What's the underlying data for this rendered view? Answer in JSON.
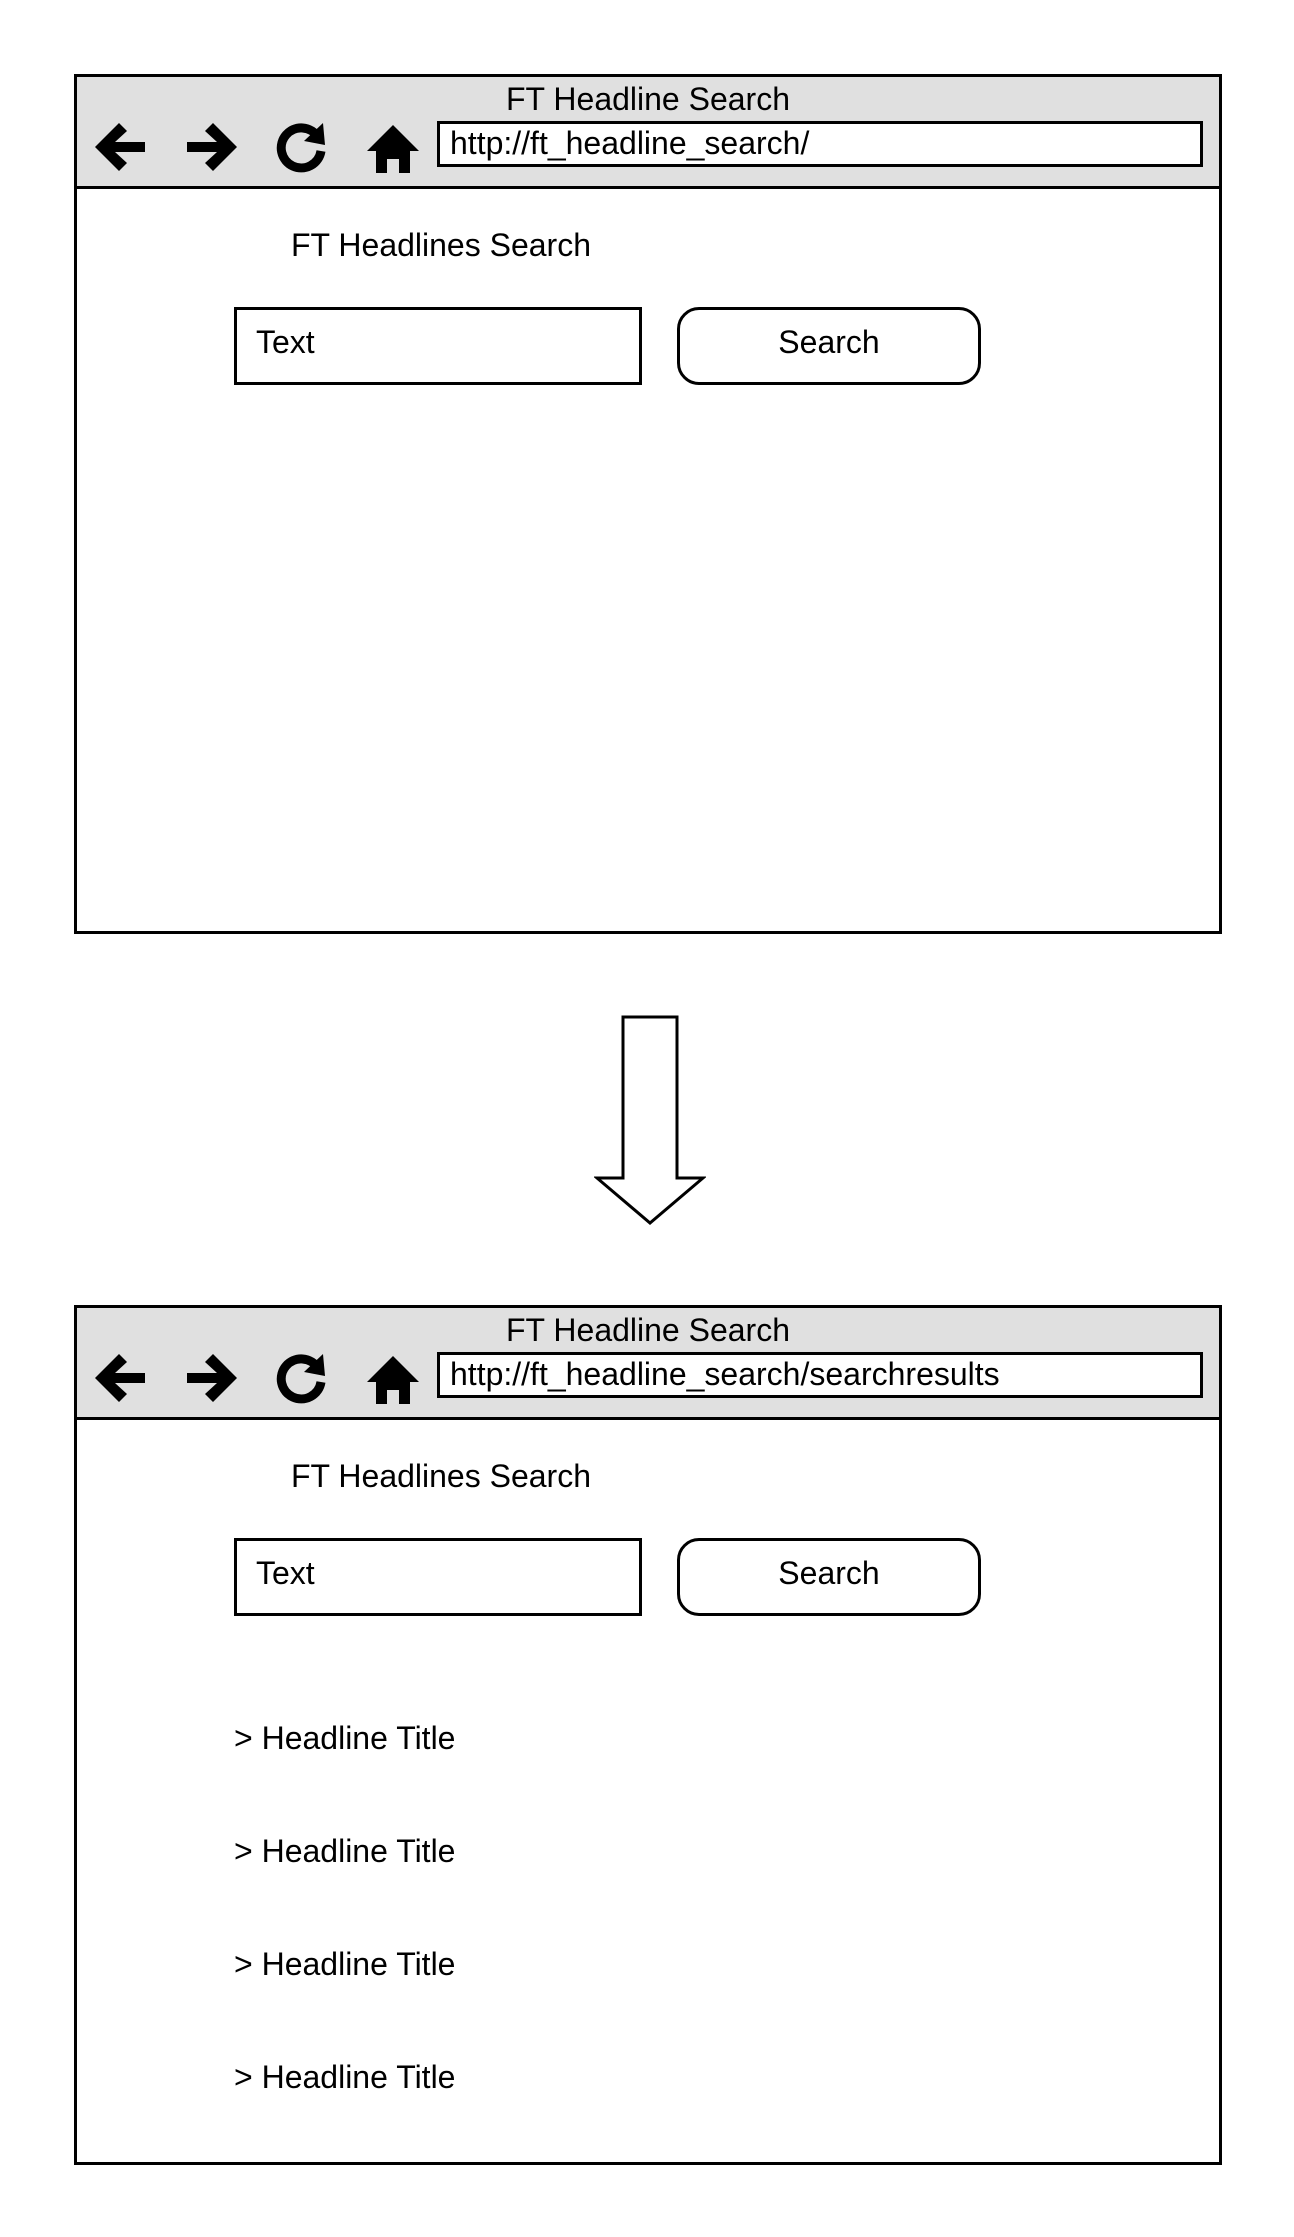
{
  "screens": [
    {
      "window_title": "FT Headline Search",
      "url": "http://ft_headline_search/",
      "heading": "FT Headlines Search",
      "input_text": "Text",
      "button_label": "Search",
      "results": []
    },
    {
      "window_title": "FT Headline Search",
      "url": "http://ft_headline_search/searchresults",
      "heading": "FT Headlines Search",
      "input_text": "Text",
      "button_label": "Search",
      "results": [
        "> Headline Title",
        "> Headline Title",
        "> Headline Title",
        "> Headline Title"
      ]
    }
  ],
  "icons": [
    "back-arrow",
    "forward-arrow",
    "reload",
    "home"
  ]
}
